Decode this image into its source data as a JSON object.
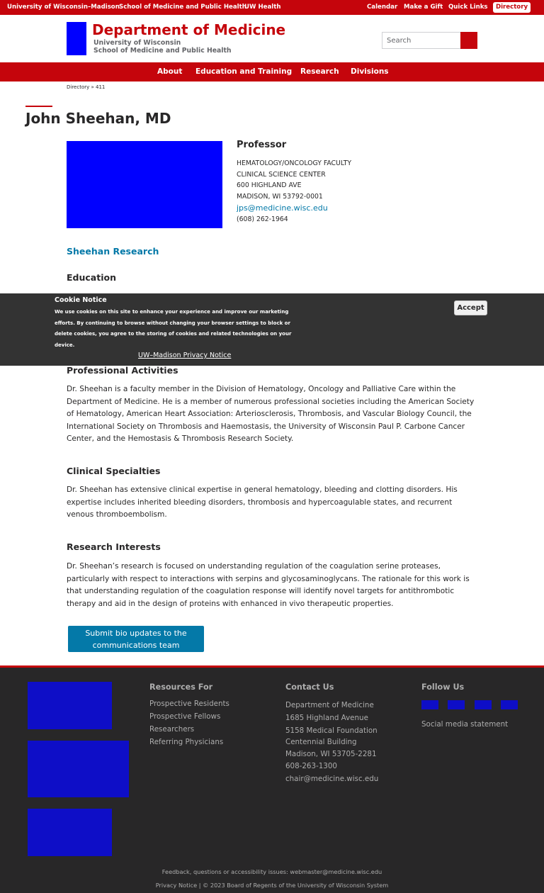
{
  "topbar": {
    "uw_madison": "University of Wisconsin–Madison",
    "school": "School of Medicine and Public Health",
    "uw_health": "UW Health",
    "calendar": "Calendar",
    "make_gift": "Make a Gift",
    "quick_links": "Quick Links",
    "directory": "Directory"
  },
  "header": {
    "title": "Department of Medicine",
    "line1": "University of Wisconsin",
    "line2": "School of Medicine and Public Health",
    "search_placeholder": "Search",
    "search_icon": "search-icon"
  },
  "nav": [
    "About",
    "Education and Training",
    "Research",
    "Divisions"
  ],
  "breadcrumb": "Directory » 411",
  "profile": {
    "name": "John Sheehan, MD",
    "role": "Professor",
    "address": [
      "HEMATOLOGY/ONCOLOGY FACULTY",
      "CLINICAL SCIENCE CENTER",
      "600 HIGHLAND AVE",
      "MADISON, WI 53792-0001"
    ],
    "email": "jps@medicine.wisc.edu",
    "phone": "(608) 262-1964",
    "research_link": "Sheehan Research"
  },
  "sections": {
    "education": "Education",
    "professional_activities": {
      "heading": "Professional Activities",
      "text": "Dr. Sheehan is a faculty member in the Division of Hematology, Oncology and Palliative Care within the Department of Medicine. He is a member of numerous professional societies including the American Society of Hematology, American Heart Association: Arteriosclerosis, Thrombosis, and Vascular Biology Council, the International Society on Thrombosis and Haemostasis, the University of Wisconsin Paul P. Carbone Cancer Center, and the Hemostasis & Thrombosis Research Society."
    },
    "clinical_specialties": {
      "heading": "Clinical Specialties",
      "text": "Dr. Sheehan has extensive clinical expertise in general hematology, bleeding and clotting disorders. His expertise includes inherited bleeding disorders, thrombosis and hypercoagulable states, and recurrent venous thromboembolism."
    },
    "research_interests": {
      "heading": "Research Interests",
      "text": "Dr. Sheehan’s research is focused on understanding regulation of the coagulation serine proteases, particularly with respect to interactions with serpins and glycosaminoglycans. The rationale for this work is that understanding regulation of the coagulation response will identify novel targets for antithrombotic therapy and aid in the design of proteins with enhanced in vivo therapeutic properties."
    }
  },
  "submit_button": "Submit bio updates to the communications team",
  "cookie": {
    "title": "Cookie Notice",
    "text": "We use cookies on this site to enhance your experience and improve our marketing efforts. By continuing to browse without changing your browser settings to block or delete cookies, you agree to the storing of cookies and related technologies on your device.",
    "link": "UW–Madison Privacy Notice",
    "accept": "Accept"
  },
  "footer": {
    "resources_heading": "Resources For",
    "resources": [
      "Prospective Residents",
      "Prospective Fellows",
      "Researchers",
      "Referring Physicians"
    ],
    "contact_heading": "Contact Us",
    "contact": [
      "Department of Medicine",
      "1685 Highland Avenue",
      "5158 Medical Foundation",
      "Centennial Building",
      "Madison, WI 53705-2281",
      "608-263-1300",
      "chair@medicine.wisc.edu"
    ],
    "follow_heading": "Follow Us",
    "social_icons": [
      "facebook-icon",
      "twitter-icon",
      "instagram-icon",
      "youtube-icon"
    ],
    "social_statement": "Social media statement",
    "feedback": "Feedback, questions or accessibility issues: webmaster@medicine.wisc.edu",
    "copyright": "Privacy Notice | © 2023 Board of Regents of the University of Wisconsin System"
  },
  "colors": {
    "brand_red": "#c5050c",
    "link_blue": "#0479a8",
    "footer_bg": "#282728",
    "cookie_bg": "#333333"
  }
}
